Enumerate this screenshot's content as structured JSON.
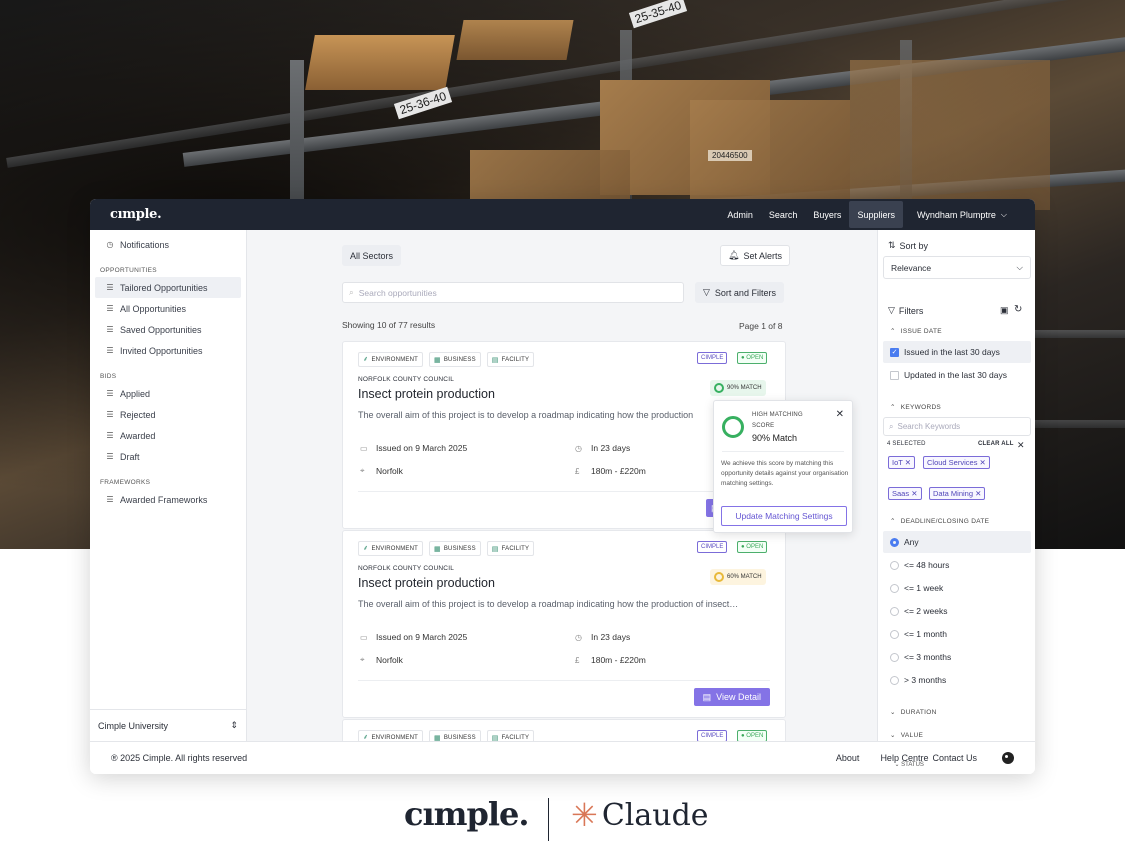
{
  "topbar": {
    "logo": "cımple.",
    "nav": [
      "Admin",
      "Search",
      "Buyers",
      "Suppliers"
    ],
    "active_nav": "Suppliers",
    "user": "Wyndham Plumptre"
  },
  "sidebar": {
    "notifications": "Notifications",
    "opportunities_header": "OPPORTUNITIES",
    "opportunities": [
      "Tailored Opportunities",
      "All Opportunities",
      "Saved Opportunities",
      "Invited Opportunities"
    ],
    "bids_header": "BIDS",
    "bids": [
      "Applied",
      "Rejected",
      "Awarded",
      "Draft"
    ],
    "frameworks_header": "FRAMEWORKS",
    "frameworks": [
      "Awarded Frameworks"
    ],
    "university": "Cimple University"
  },
  "main": {
    "sector_chip": "All Sectors",
    "set_alerts": "Set Alerts",
    "search_placeholder": "Search opportunities",
    "sort_filters": "Sort and Filters",
    "showing": "Showing 10 of 77 results",
    "page": "Page 1 of 8",
    "cards": [
      {
        "tags": [
          "ENVIRONMENT",
          "BUSINESS",
          "FACILITY"
        ],
        "source": "CIMPLE",
        "status": "OPEN",
        "council": "NORFOLK COUNTY COUNCIL",
        "title": "Insect protein production",
        "desc": "The overall aim of this project is to develop a roadmap indicating how the production",
        "issued": "Issued on 9 March 2025",
        "deadline": "In 23 days",
        "location": "Norfolk",
        "value": "180m - £220m",
        "match": "90% MATCH",
        "view": "View Detail"
      },
      {
        "tags": [
          "ENVIRONMENT",
          "BUSINESS",
          "FACILITY"
        ],
        "source": "CIMPLE",
        "status": "OPEN",
        "council": "NORFOLK COUNTY COUNCIL",
        "title": "Insect protein production",
        "desc": "The overall aim of this project is to develop a roadmap indicating how the production of insect…",
        "issued": "Issued on 9 March 2025",
        "deadline": "In 23 days",
        "location": "Norfolk",
        "value": "180m - £220m",
        "match": "60% MATCH",
        "view": "View Detail"
      },
      {
        "tags": [
          "ENVIRONMENT",
          "BUSINESS",
          "FACILITY"
        ],
        "source": "CIMPLE",
        "status": "OPEN"
      }
    ]
  },
  "popover": {
    "label": "HIGH MATCHING SCORE",
    "score": "90% Match",
    "body": "We achieve this score by matching this opportunity details against your organisation matching settings.",
    "button": "Update Matching Settings"
  },
  "filters": {
    "sort_by": "Sort by",
    "sort_value": "Relevance",
    "filters_label": "Filters",
    "issue_date_header": "ISSUE DATE",
    "issue_options": [
      "Issued in the last 30 days",
      "Updated in the last 30 days"
    ],
    "keywords_header": "KEYWORDS",
    "keywords_placeholder": "Search Keywords",
    "selected_count": "4 SELECTED",
    "clear_all": "CLEAR ALL",
    "keywords": [
      "IoT",
      "Cloud Services",
      "Saas",
      "Data Mining"
    ],
    "deadline_header": "DEADLINE/CLOSING DATE",
    "deadline_options": [
      "Any",
      "<= 48 hours",
      "<= 1 week",
      "<= 2 weeks",
      "<= 1 month",
      "<= 3 months",
      "> 3 months"
    ],
    "duration_header": "DURATION",
    "value_header": "VALUE",
    "status_header": "STATUS"
  },
  "footer": {
    "copyright": "® 2025 Cimple. All rights reserved",
    "links": [
      "About",
      "Help Centre",
      "Contact Us"
    ]
  },
  "brand": {
    "cimple": "cımple.",
    "claude": "Claude"
  },
  "rack_labels": [
    "25-35-40",
    "25-36-40",
    "20446500"
  ],
  "colors": {
    "accent": "#8473e6",
    "dark": "#1f2531",
    "open_green": "#3aa85a",
    "match_high": "#37b060",
    "match_mid": "#e8b93a",
    "claude_orange": "#d97757"
  }
}
